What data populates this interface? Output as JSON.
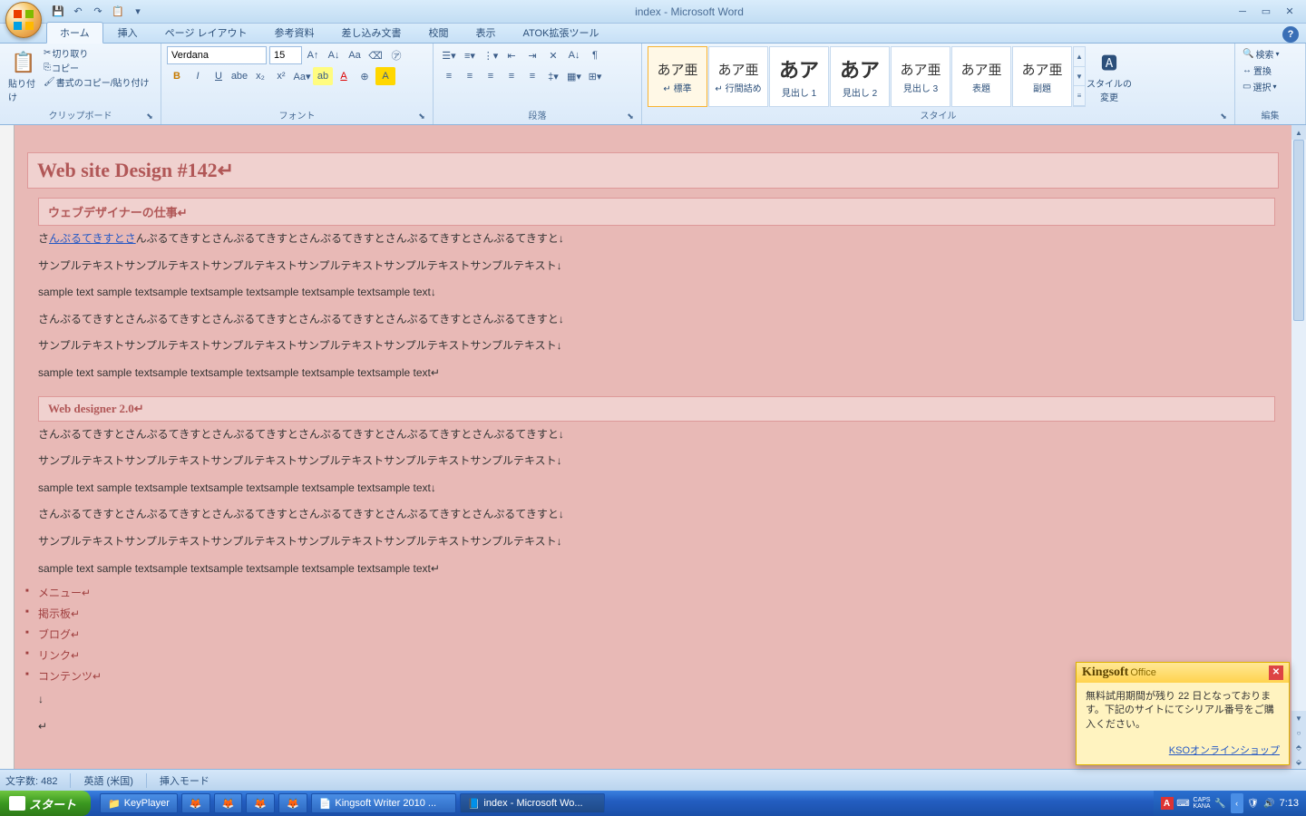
{
  "titlebar": {
    "title": "index - Microsoft Word"
  },
  "qat": {
    "save": "💾",
    "undo": "↶",
    "redo": "↷",
    "more": "▾"
  },
  "tabs": [
    {
      "label": "ホーム",
      "active": true
    },
    {
      "label": "挿入"
    },
    {
      "label": "ページ レイアウト"
    },
    {
      "label": "参考資料"
    },
    {
      "label": "差し込み文書"
    },
    {
      "label": "校閲"
    },
    {
      "label": "表示"
    },
    {
      "label": "ATOK拡張ツール"
    }
  ],
  "ribbon": {
    "clipboard": {
      "label": "クリップボード",
      "paste": "貼り付け",
      "cut": "切り取り",
      "copy": "コピー",
      "format": "書式のコピー/貼り付け"
    },
    "font": {
      "label": "フォント",
      "name": "Verdana",
      "size": "15"
    },
    "paragraph": {
      "label": "段落"
    },
    "styles": {
      "label": "スタイル",
      "items": [
        {
          "preview": "あア亜",
          "label": "↵ 標準",
          "sel": true
        },
        {
          "preview": "あア亜",
          "label": "↵ 行間詰め"
        },
        {
          "preview": "あア",
          "label": "見出し 1",
          "big": true
        },
        {
          "preview": "あア",
          "label": "見出し 2",
          "big": true
        },
        {
          "preview": "あア亜",
          "label": "見出し 3"
        },
        {
          "preview": "あア亜",
          "label": "表題"
        },
        {
          "preview": "あア亜",
          "label": "副題"
        }
      ],
      "change": "スタイルの\n変更"
    },
    "editing": {
      "label": "編集",
      "find": "検索",
      "replace": "置換",
      "select": "選択"
    }
  },
  "document": {
    "h1": "Web site Design #142",
    "h2a": "ウェブデザイナーの仕事",
    "p1_pre": "さ",
    "p1_link": "んぷるてきすとさ",
    "p1_post": "んぷるてきすとさんぷるてきすとさんぷるてきすとさんぷるてきすとさんぷるてきすと↓",
    "p2": "サンプルテキストサンプルテキストサンプルテキストサンプルテキストサンプルテキストサンプルテキスト↓",
    "p3": "sample text sample textsample textsample textsample textsample textsample text↓",
    "p4": "さんぷるてきすとさんぷるてきすとさんぷるてきすとさんぷるてきすとさんぷるてきすとさんぷるてきすと↓",
    "p5": "サンプルテキストサンプルテキストサンプルテキストサンプルテキストサンプルテキストサンプルテキスト↓",
    "p6": "sample text sample textsample textsample textsample textsample textsample text↵",
    "h2b": "Web designer 2.0",
    "p7": "さんぷるてきすとさんぷるてきすとさんぷるてきすとさんぷるてきすとさんぷるてきすとさんぷるてきすと↓",
    "p8": "サンプルテキストサンプルテキストサンプルテキストサンプルテキストサンプルテキストサンプルテキスト↓",
    "p9": "sample text sample textsample textsample textsample textsample textsample text↓",
    "p10": "さんぷるてきすとさんぷるてきすとさんぷるてきすとさんぷるてきすとさんぷるてきすとさんぷるてきすと↓",
    "p11": "サンプルテキストサンプルテキストサンプルテキストサンプルテキストサンプルテキストサンプルテキスト↓",
    "p12": "sample text sample textsample textsample textsample textsample textsample text↵",
    "li1": "メニュー↵",
    "li2": "掲示板↵",
    "li3": "ブログ↵",
    "li4": "リンク↵",
    "li5": "コンテンツ↵",
    "blank1": "↓",
    "blank2": "↵"
  },
  "status": {
    "words": "文字数: 482",
    "lang": "英語 (米国)",
    "mode": "挿入モード"
  },
  "popup": {
    "brand": "Kingsoft",
    "office": "Office",
    "body": "無料試用期間が残り 22 日となっております。下記のサイトにてシリアル番号をご購入ください。",
    "link": "KSOオンラインショップ"
  },
  "taskbar": {
    "start": "スタート",
    "items": [
      {
        "icon": "📁",
        "label": "KeyPlayer"
      },
      {
        "icon": "🦊",
        "label": ""
      },
      {
        "icon": "🦊",
        "label": ""
      },
      {
        "icon": "🦊",
        "label": ""
      },
      {
        "icon": "🦊",
        "label": ""
      },
      {
        "icon": "📄",
        "label": "Kingsoft Writer 2010 ...",
        "active": false
      },
      {
        "icon": "📘",
        "label": "index - Microsoft Wo...",
        "active": true
      }
    ],
    "caps": "CAPS",
    "kana": "KANA",
    "clock": "7:13"
  }
}
